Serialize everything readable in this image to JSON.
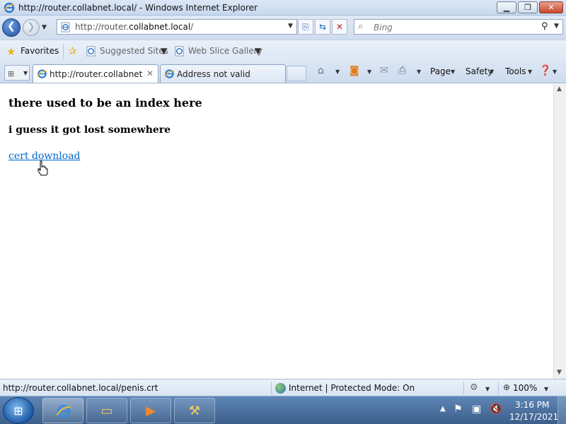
{
  "window": {
    "title": "http://router.collabnet.local/ - Windows Internet Explorer",
    "minimize_glyph": "▁",
    "maximize_glyph": "❐",
    "close_glyph": "✕"
  },
  "address_bar": {
    "url_prefix": "http://router.",
    "url_host": "collabnet.local",
    "url_suffix": "/",
    "search_placeholder": "Bing"
  },
  "favorites_bar": {
    "favorites_label": "Favorites",
    "suggested_sites_label": "Suggested Sites",
    "web_slice_gallery_label": "Web Slice Gallery"
  },
  "tabs": [
    {
      "label": "http://router.collabnet....",
      "active": true
    },
    {
      "label": "Address not valid",
      "active": false
    }
  ],
  "command_bar": {
    "page_label": "Page",
    "safety_label": "Safety",
    "tools_label": "Tools"
  },
  "content": {
    "heading": "there used to be an index here",
    "subheading": "i guess it got lost somewhere",
    "link_text": "cert download"
  },
  "status_bar": {
    "status_url": "http://router.collabnet.local/penis.crt",
    "zone_text": "Internet | Protected Mode: On",
    "zoom_level": "100%"
  },
  "taskbar": {
    "time": "3:16 PM",
    "date": "12/17/2021"
  },
  "colors": {
    "link": "#0066cc",
    "titlebar": "#dbe7f5",
    "taskbar": "#3c5f8b"
  },
  "icons": {
    "back": "back-arrow-icon",
    "forward": "forward-arrow-icon",
    "refresh": "refresh-icon",
    "stop": "stop-icon",
    "search": "search-icon",
    "favorites": "favorites-star-icon",
    "home": "home-icon",
    "feeds": "rss-feed-icon",
    "mail": "mail-icon",
    "print": "printer-icon",
    "help": "help-icon"
  }
}
